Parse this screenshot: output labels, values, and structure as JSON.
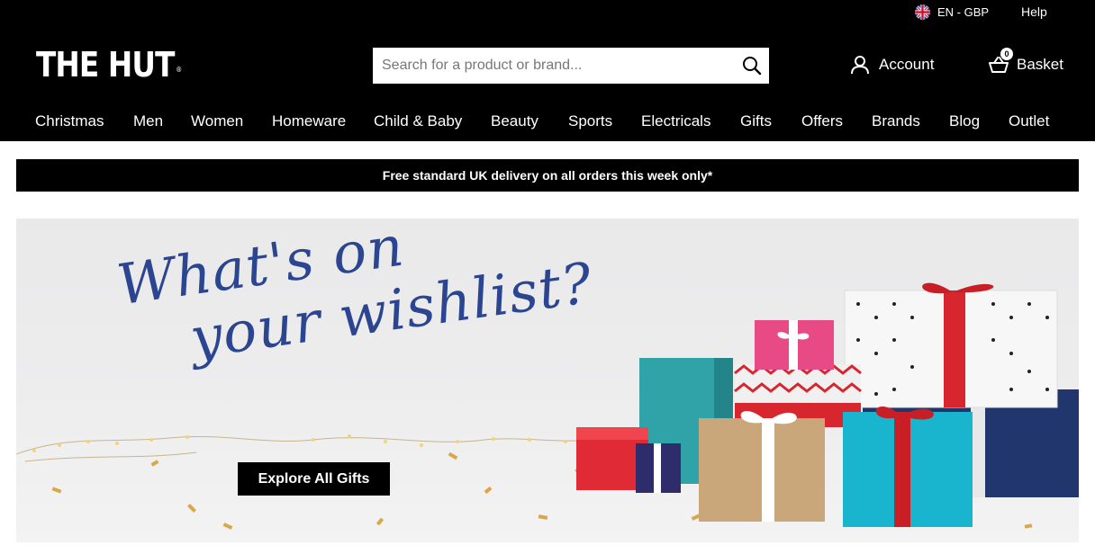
{
  "header": {
    "locale_label": "EN - GBP",
    "help_label": "Help",
    "logo_text": "THE HUT",
    "logo_mark": "®",
    "search_placeholder": "Search for a product or brand...",
    "account_label": "Account",
    "basket_label": "Basket",
    "basket_count": "0"
  },
  "nav": {
    "items": [
      {
        "label": "Christmas"
      },
      {
        "label": "Men"
      },
      {
        "label": "Women"
      },
      {
        "label": "Homeware"
      },
      {
        "label": "Child & Baby"
      },
      {
        "label": "Beauty"
      },
      {
        "label": "Sports"
      },
      {
        "label": "Electricals"
      },
      {
        "label": "Gifts"
      },
      {
        "label": "Offers"
      },
      {
        "label": "Brands"
      },
      {
        "label": "Blog"
      },
      {
        "label": "Outlet"
      }
    ]
  },
  "promo": {
    "text": "Free standard UK delivery on all orders this week only*"
  },
  "hero": {
    "headline_line1": "What's on",
    "headline_line2": "your wishlist?",
    "cta_label": "Explore All Gifts"
  },
  "colors": {
    "header_bg": "#000000",
    "headline": "#2b4590",
    "gift_red": "#d7262e",
    "gift_teal": "#2fa3a8",
    "gift_navy": "#21366d",
    "gift_pink": "#e84a86",
    "gift_cyan": "#19b5cf"
  }
}
